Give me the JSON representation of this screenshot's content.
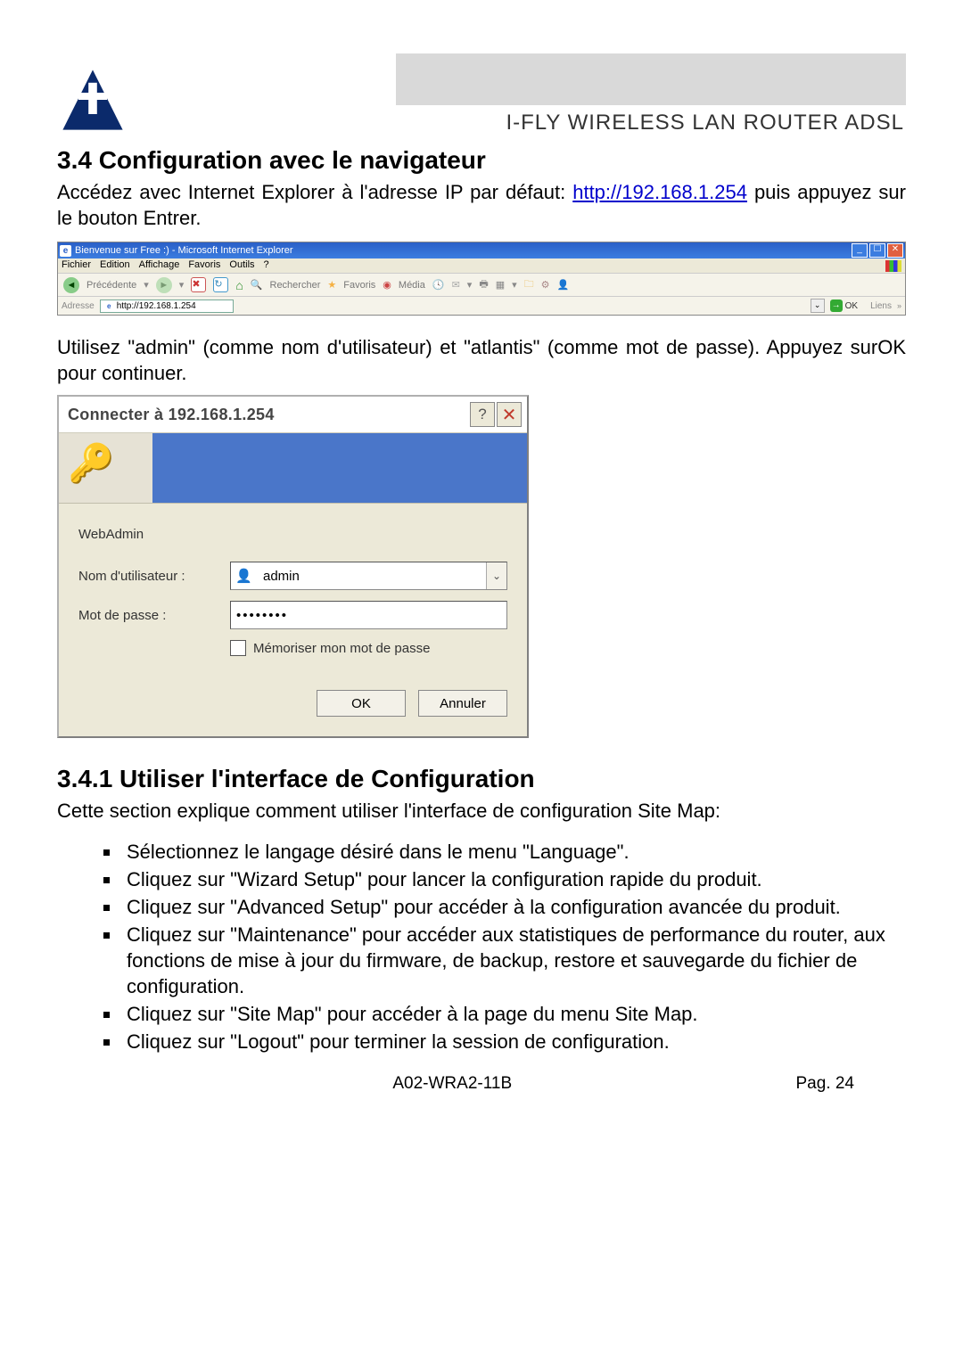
{
  "header": {
    "product_title": "I-FLY WIRELESS LAN ROUTER ADSL"
  },
  "section": {
    "number_title": "3.4 Configuration avec le navigateur",
    "intro_pre": "Accédez avec Internet Explorer à l'adresse IP par défaut: ",
    "intro_link": "http://192.168.1.254",
    "intro_post": " puis appuyez sur le bouton Entrer.",
    "credentials_text": "Utilisez \"admin\" (comme nom d'utilisateur) et \"atlantis\" (comme mot de passe). Appuyez surOK pour continuer."
  },
  "ie": {
    "window_title": "Bienvenue sur Free :) - Microsoft Internet Explorer",
    "menus": [
      "Fichier",
      "Edition",
      "Affichage",
      "Favoris",
      "Outils",
      "?"
    ],
    "tb_back": "Précédente",
    "tb_search": "Rechercher",
    "tb_fav": "Favoris",
    "tb_media": "Média",
    "addr_label": "Adresse",
    "addr_value": "http://192.168.1.254",
    "go": "OK",
    "links": "Liens"
  },
  "login": {
    "title": "Connecter à 192.168.1.254",
    "realm": "WebAdmin",
    "user_label": "Nom d'utilisateur :",
    "user_value": "admin",
    "pass_label": "Mot de passe :",
    "pass_value": "••••••••",
    "remember": "Mémoriser mon mot de passe",
    "ok": "OK",
    "cancel": "Annuler"
  },
  "subsection": {
    "title": "3.4.1 Utiliser l'interface de Configuration",
    "intro": "Cette section explique comment utiliser l'interface de configuration Site Map:",
    "bullets": [
      "Sélectionnez le langage désiré dans le menu \"Language\".",
      "Cliquez sur \"Wizard Setup\" pour lancer la configuration rapide du produit.",
      "Cliquez sur \"Advanced Setup\" pour accéder à la configuration avancée du produit.",
      "Cliquez sur \"Maintenance\"  pour accéder aux statistiques de performance du router, aux fonctions de mise à jour du firmware, de backup, restore et sauvegarde du fichier de configuration.",
      "Cliquez sur \"Site Map\"  pour accéder à la page du menu Site Map.",
      "Cliquez sur \"Logout\" pour terminer la session de configuration."
    ]
  },
  "footer": {
    "model": "A02-WRA2-11B",
    "page": "Pag. 24"
  }
}
